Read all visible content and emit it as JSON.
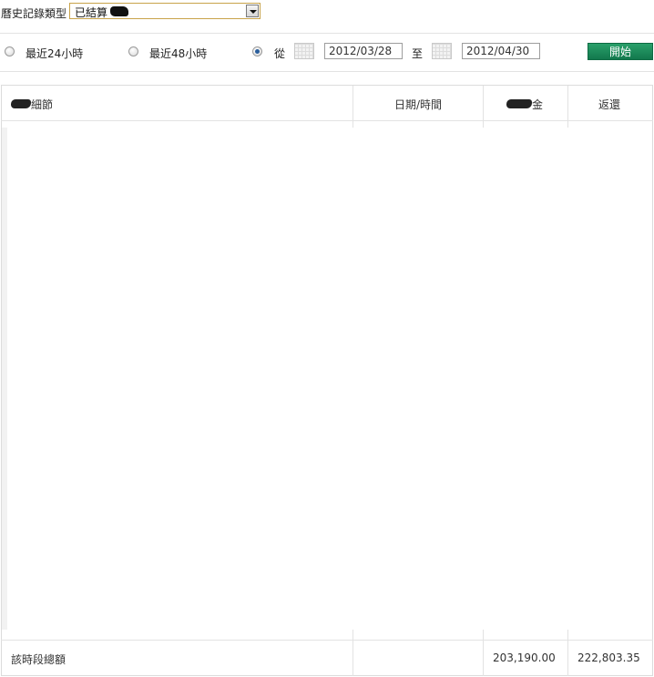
{
  "filter": {
    "history_type_label": "曆史記錄類型",
    "history_type_value": "已結算"
  },
  "range": {
    "last24_label": "最近24小時",
    "last48_label": "最近48小時",
    "from_label": "從",
    "to_label": "至",
    "start_date": "2012/03/28",
    "end_date": "2012/04/30",
    "selected": "custom",
    "start_button": "開始"
  },
  "table": {
    "headers": [
      "細節",
      "日期/時間",
      "金",
      "返還"
    ],
    "rows": [],
    "footer": {
      "label": "該時段總額",
      "amount": "203,190.00",
      "returned": "222,803.35"
    }
  },
  "colors": {
    "accent_button": "#1a8a5a",
    "select_border": "#c8a34a",
    "radio_selected": "#2a5e9c"
  }
}
